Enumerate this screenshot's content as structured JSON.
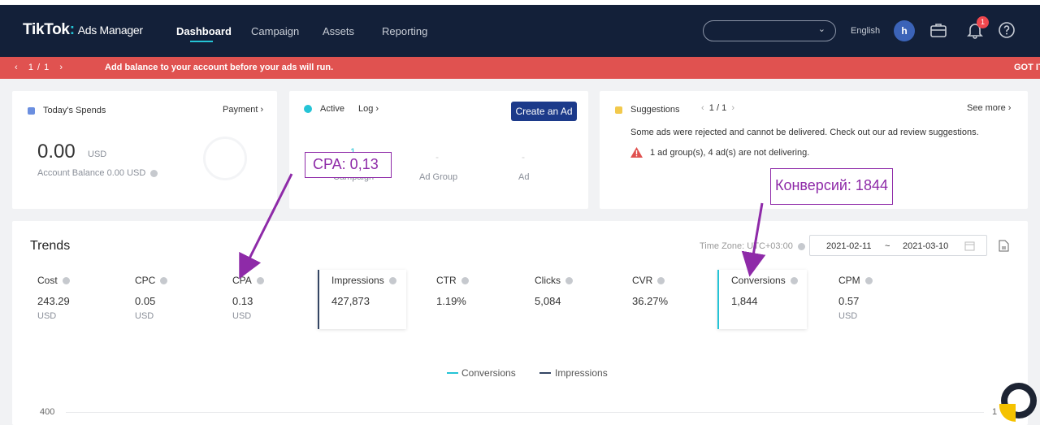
{
  "nav": {
    "logo": "TikTok",
    "logo_sub": "Ads Manager",
    "tabs": [
      {
        "label": "Dashboard"
      },
      {
        "label": "Campaign"
      },
      {
        "label": "Assets"
      },
      {
        "label": "Reporting"
      }
    ],
    "language": "English",
    "avatar_letter": "h",
    "notification_count": "1"
  },
  "alert": {
    "pager": "1  /  1",
    "message": "Add balance to your account before your ads will run.",
    "dismiss": "GOT IT"
  },
  "spend_card": {
    "title": "Today's Spends",
    "payment_link": "Payment",
    "amount": "0.00",
    "currency": "USD",
    "balance_text": "Account Balance 0.00 USD"
  },
  "active_card": {
    "status": "Active",
    "log_link": "Log",
    "create_button": "Create an Ad",
    "counts": [
      {
        "value": "1",
        "label": "Campaign"
      },
      {
        "value": "-",
        "label": "Ad Group"
      },
      {
        "value": "-",
        "label": "Ad"
      }
    ]
  },
  "suggestions": {
    "title": "Suggestions",
    "pager": "1 / 1",
    "see_more": "See more",
    "line1": "Some ads were rejected and cannot be delivered. Check out our ad review suggestions.",
    "line2": "1 ad group(s), 4 ad(s) are not delivering."
  },
  "trends": {
    "title": "Trends",
    "timezone": "Time Zone: UTC+03:00",
    "date_from": "2021-02-11",
    "date_sep": "~",
    "date_to": "2021-03-10",
    "metrics": [
      {
        "label": "Cost",
        "value": "243.29",
        "unit": "USD"
      },
      {
        "label": "CPC",
        "value": "0.05",
        "unit": "USD"
      },
      {
        "label": "CPA",
        "value": "0.13",
        "unit": "USD"
      },
      {
        "label": "Impressions",
        "value": "427,873",
        "unit": ""
      },
      {
        "label": "CTR",
        "value": "1.19%",
        "unit": ""
      },
      {
        "label": "Clicks",
        "value": "5,084",
        "unit": ""
      },
      {
        "label": "CVR",
        "value": "36.27%",
        "unit": ""
      },
      {
        "label": "Conversions",
        "value": "1,844",
        "unit": ""
      },
      {
        "label": "CPM",
        "value": "0.57",
        "unit": "USD"
      }
    ],
    "legend": [
      {
        "name": "Conversions",
        "color": "#25c4d6"
      },
      {
        "name": "Impressions",
        "color": "#344563"
      }
    ],
    "y_tick_left": "400",
    "y_tick_right": "1"
  },
  "annotations": {
    "cpa_note": "CPA: 0,13",
    "conv_note": "Конверсий: 1844"
  },
  "colors": {
    "navbar": "#132039",
    "alert": "#e05250",
    "accent": "#25c4d6",
    "annotation": "#8e2aa8"
  }
}
